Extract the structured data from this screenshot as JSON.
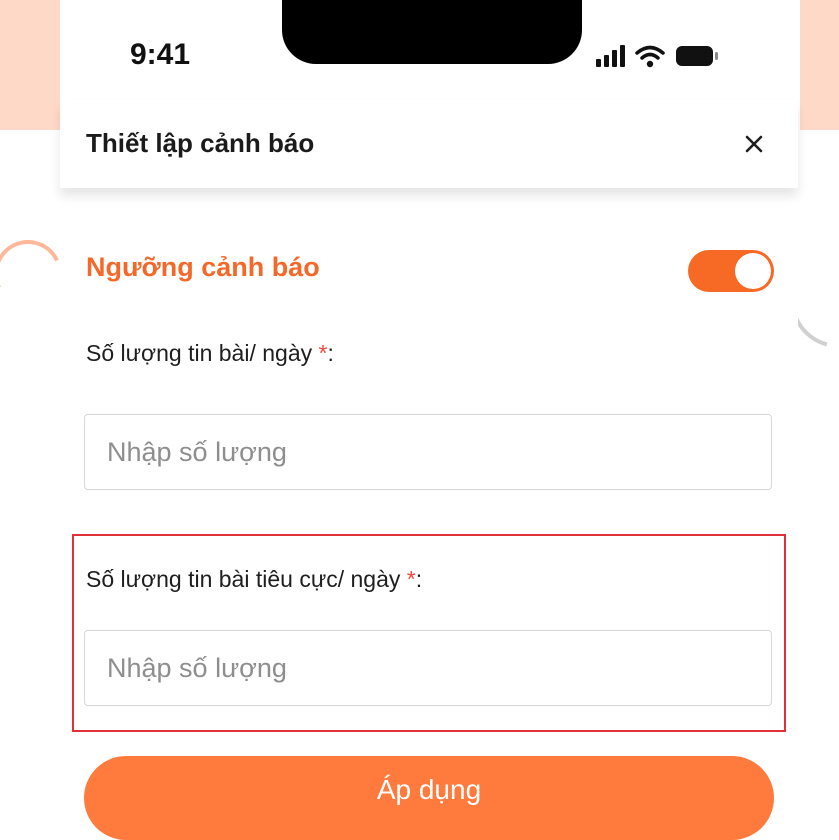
{
  "status_bar": {
    "time": "9:41"
  },
  "header": {
    "title": "Thiết lập cảnh báo"
  },
  "threshold": {
    "title": "Ngưỡng cảnh báo",
    "enabled": true
  },
  "fields": [
    {
      "label": "Số lượng tin bài/ ngày",
      "required_mark": "*",
      "suffix": ":",
      "placeholder": "Nhập số lượng",
      "value": ""
    },
    {
      "label": "Số lượng tin bài tiêu cực/ ngày",
      "required_mark": "*",
      "suffix": ":",
      "placeholder": "Nhập số lượng",
      "value": ""
    }
  ],
  "apply_button": {
    "label": "Áp dụng"
  },
  "colors": {
    "accent": "#f76a26",
    "button": "#ff7b3d",
    "required": "#f0473f",
    "highlight": "#e0313b"
  },
  "icons": [
    "signal-icon",
    "wifi-icon",
    "battery-icon",
    "close-icon"
  ]
}
